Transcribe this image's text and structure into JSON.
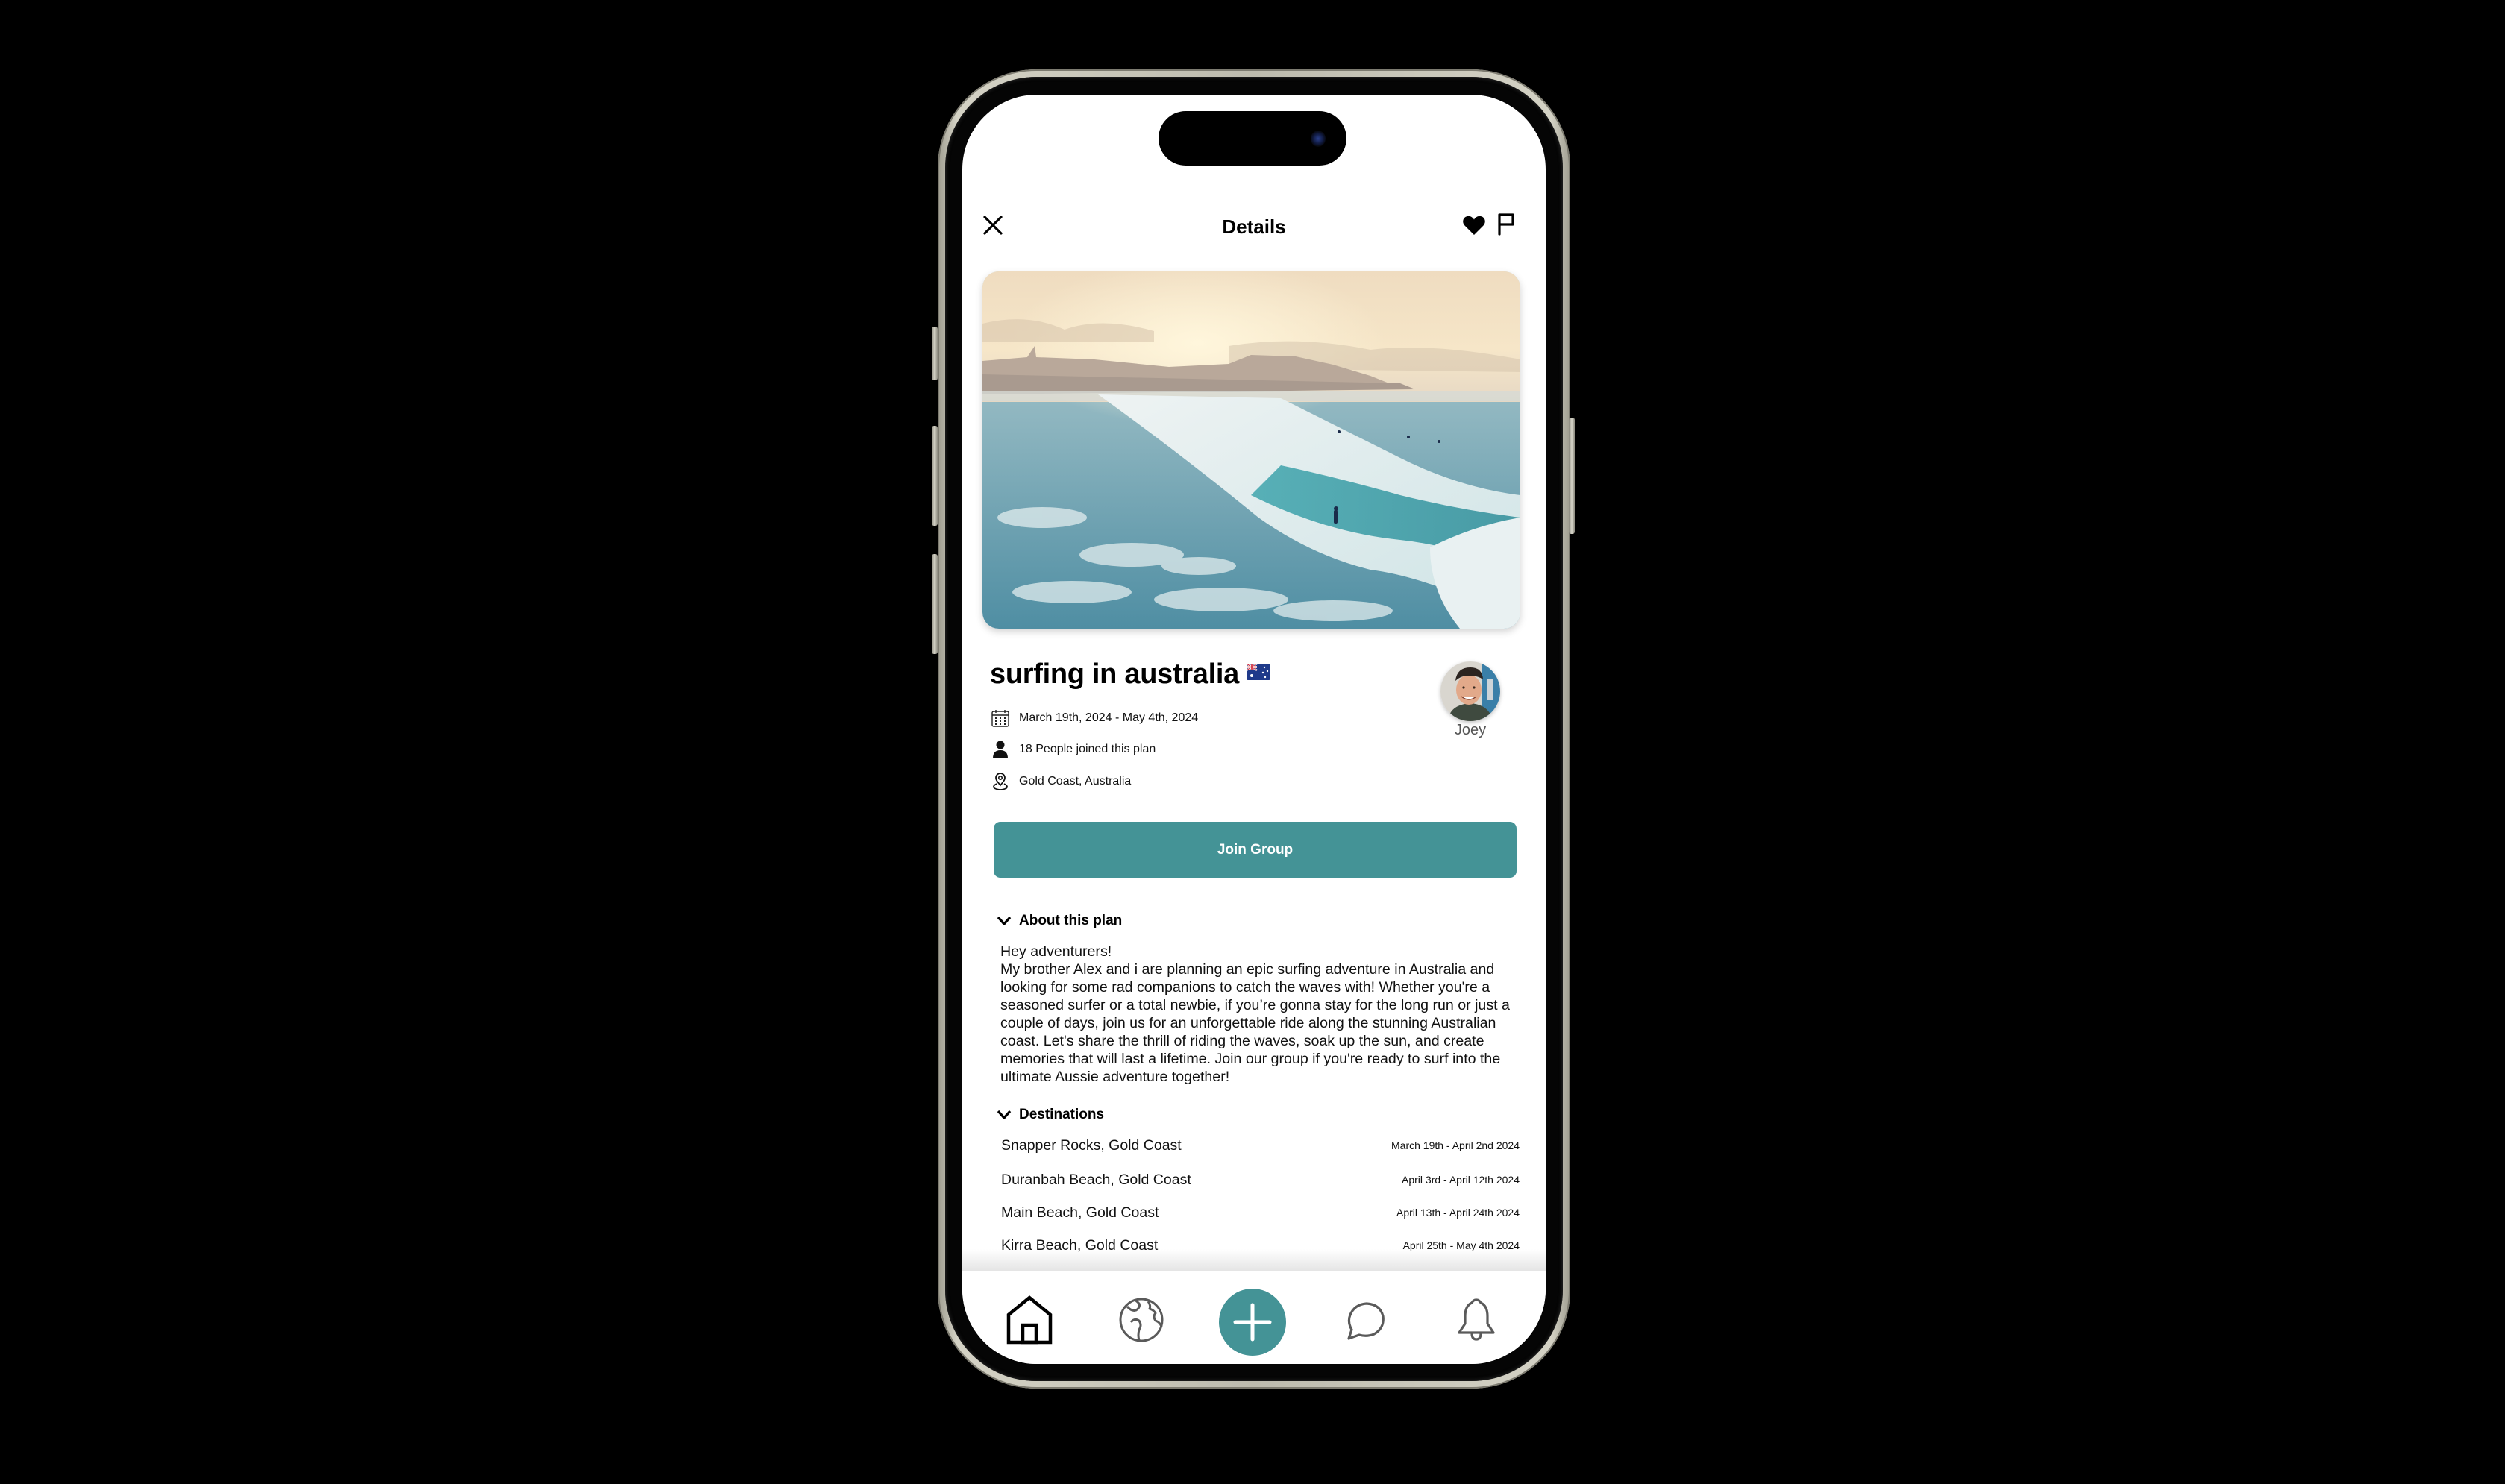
{
  "header": {
    "title": "Details",
    "close_icon": "close-icon",
    "favorite_icon": "heart-icon",
    "report_icon": "flag-icon"
  },
  "hero": {
    "alt": "Aerial view of a surfer riding a breaking wave at sunset with a coastal town in the background"
  },
  "plan": {
    "title": "surfing in australia",
    "title_emoji": "🇦🇺",
    "date_range": "March 19th, 2024 - May 4th, 2024",
    "participants": "18 People joined this plan",
    "location": "Gold Coast, Australia",
    "organizer": {
      "name": "Joey"
    }
  },
  "actions": {
    "join_label": "Join Group"
  },
  "about": {
    "heading": "About this plan",
    "body": "Hey adventurers!\nMy brother Alex and i are planning an epic surfing adventure in Australia and looking for some rad companions to catch the waves with! Whether you're a seasoned surfer or a total newbie, if you’re gonna stay for the long run or just a couple of days, join us for an unforgettable ride along the stunning Australian coast. Let's share the thrill of riding the waves, soak up the sun, and create memories that will last a lifetime. Join our group if you're ready to surf into the ultimate Aussie adventure together!"
  },
  "destinations": {
    "heading": "Destinations",
    "items": [
      {
        "name": "Snapper Rocks, Gold Coast",
        "dates": "March 19th - April 2nd 2024"
      },
      {
        "name": "Duranbah Beach, Gold Coast",
        "dates": "April 3rd - April 12th 2024"
      },
      {
        "name": "Main Beach, Gold Coast",
        "dates": "April 13th - April 24th 2024"
      },
      {
        "name": "Kirra Beach, Gold Coast",
        "dates": "April 25th - May 4th 2024"
      }
    ]
  },
  "nav": {
    "items": [
      {
        "icon": "home-icon",
        "active": true
      },
      {
        "icon": "globe-icon",
        "active": false
      },
      {
        "icon": "plus-icon",
        "active": false
      },
      {
        "icon": "chat-icon",
        "active": false
      },
      {
        "icon": "bell-icon",
        "active": false
      }
    ]
  },
  "colors": {
    "accent": "#449396",
    "background": "#000000",
    "text": "#111111",
    "icon_inactive": "#5a5a5a"
  }
}
